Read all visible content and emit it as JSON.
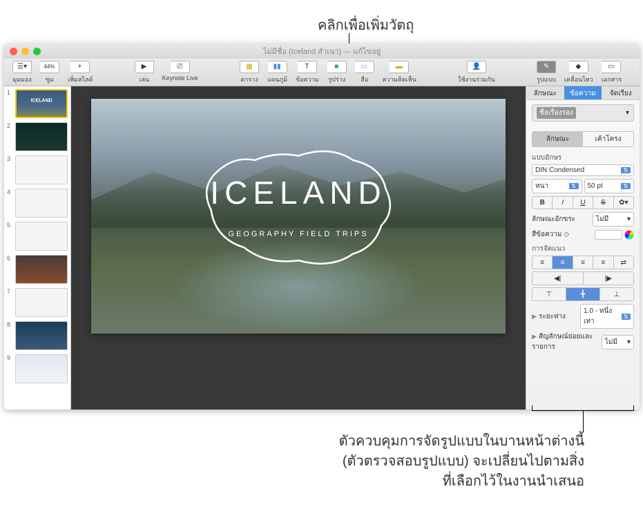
{
  "callouts": {
    "top": "คลิกเพื่อเพิ่มวัตถุ",
    "bottom": "ตัวควบคุมการจัดรูปแบบในบานหน้าต่างนี้\n(ตัวตรวจสอบรูปแบบ) จะเปลี่ยนไปตามสิ่ง\nที่เลือกไว้ในงานนำเสนอ"
  },
  "window": {
    "title": "ไม่มีชื่อ (Iceland สำเนา) — แก้ไขอยู่"
  },
  "toolbar": {
    "view": "มุมมอง",
    "zoom": "ซูม",
    "zoom_value": "44%",
    "addslide": "เพิ่มสไลด์",
    "play": "เล่น",
    "keynote_live": "Keynote Live",
    "table": "ตาราง",
    "chart": "แผนภูมิ",
    "text": "ข้อความ",
    "shape": "รูปร่าง",
    "media": "สื่อ",
    "comment": "ความคิดเห็น",
    "collaborate": "ใช้งานร่วมกัน",
    "format": "รูปแบบ",
    "animate": "เคลื่อนไหว",
    "document": "เอกสาร"
  },
  "slide": {
    "title": "ICELAND",
    "subtitle": "GEOGRAPHY FIELD TRIPS"
  },
  "thumbs": [
    "1",
    "2",
    "3",
    "4",
    "5",
    "6",
    "7",
    "8",
    "9"
  ],
  "inspector": {
    "tabs": {
      "style": "ลักษณะ",
      "text": "ข้อความ",
      "arrange": "จัดเรียง"
    },
    "paragraph_style": "ชื่อเรื่องรอง",
    "subtabs": {
      "style": "ลักษณะ",
      "layout": "เค้าโครง"
    },
    "font_label": "แบบอักษร",
    "font_family": "DIN Condensed",
    "font_style": "หนา",
    "font_size": "50 pt",
    "char_style_label": "ลักษณะอักขระ",
    "char_style_value": "ไม่มี",
    "text_color_label": "สีข้อความ",
    "alignment_label": "การจัดแนว",
    "spacing_label": "ระยะห่าง",
    "spacing_value": "1.0 - หนึ่งเท่า",
    "bullets_label": "สัญลักษณ์ย่อยและรายการ",
    "bullets_value": "ไม่มี",
    "bold": "B",
    "italic": "I",
    "underline": "U",
    "strike": "S",
    "gear": "✿"
  }
}
